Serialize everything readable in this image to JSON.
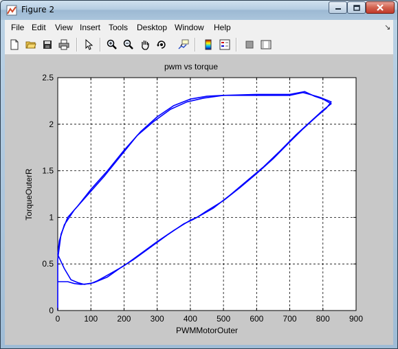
{
  "window": {
    "title": "Figure 2"
  },
  "menu": [
    "File",
    "Edit",
    "View",
    "Insert",
    "Tools",
    "Desktop",
    "Window",
    "Help"
  ],
  "toolbar": [
    {
      "icon": "new-figure-icon"
    },
    {
      "icon": "open-file-icon"
    },
    {
      "icon": "save-icon"
    },
    {
      "icon": "print-icon"
    },
    {
      "icon": "edit-plot-arrow-icon"
    },
    {
      "icon": "zoom-in-icon"
    },
    {
      "icon": "zoom-out-icon"
    },
    {
      "icon": "pan-hand-icon"
    },
    {
      "icon": "rotate-3d-icon"
    },
    {
      "icon": "data-cursor-icon"
    },
    {
      "icon": "insert-colorbar-icon"
    },
    {
      "icon": "insert-legend-icon"
    },
    {
      "icon": "hide-plot-tools-icon"
    },
    {
      "icon": "show-plot-tools-icon"
    }
  ],
  "chart_data": {
    "type": "line",
    "title": "pwm vs torque",
    "xlabel": "PWMMotorOuter",
    "ylabel": "TorqueOuterR",
    "xlim": [
      0,
      900
    ],
    "ylim": [
      0,
      2.5
    ],
    "xticks": [
      "0",
      "100",
      "200",
      "300",
      "400",
      "500",
      "600",
      "700",
      "800",
      "900"
    ],
    "yticks": [
      "0",
      "0.5",
      "1",
      "1.5",
      "2",
      "2.5"
    ],
    "grid": true,
    "color": "#0000ff",
    "series": [
      {
        "x": [
          0,
          0,
          10,
          30,
          60,
          100,
          150,
          200,
          250,
          300,
          350,
          400,
          450,
          500,
          600,
          700,
          740,
          760,
          790,
          825,
          810,
          780,
          740,
          700,
          650,
          600,
          550,
          500,
          450,
          420,
          400,
          350,
          300,
          250,
          200,
          160,
          120,
          100,
          70,
          50,
          30,
          0
        ],
        "y": [
          0,
          0.55,
          0.82,
          1.0,
          1.12,
          1.3,
          1.5,
          1.72,
          1.92,
          2.08,
          2.2,
          2.27,
          2.3,
          2.31,
          2.31,
          2.31,
          2.34,
          2.32,
          2.29,
          2.24,
          2.17,
          2.08,
          1.95,
          1.81,
          1.63,
          1.47,
          1.32,
          1.18,
          1.07,
          1.0,
          0.97,
          0.86,
          0.74,
          0.61,
          0.48,
          0.4,
          0.32,
          0.29,
          0.28,
          0.29,
          0.31,
          0.31
        ]
      },
      {
        "x": [
          0,
          5,
          20,
          50,
          90,
          140,
          190,
          240,
          290,
          340,
          390,
          440,
          500,
          600,
          700,
          745,
          775,
          800,
          825,
          800,
          760,
          720,
          670,
          620,
          570,
          520,
          470,
          440,
          410,
          380,
          330,
          280,
          230,
          190,
          150,
          110,
          80,
          60,
          40,
          20,
          0
        ],
        "y": [
          0.6,
          0.75,
          0.92,
          1.08,
          1.24,
          1.44,
          1.66,
          1.88,
          2.03,
          2.16,
          2.24,
          2.28,
          2.31,
          2.32,
          2.32,
          2.35,
          2.3,
          2.27,
          2.22,
          2.15,
          2.02,
          1.89,
          1.71,
          1.54,
          1.39,
          1.24,
          1.1,
          1.04,
          0.98,
          0.93,
          0.81,
          0.68,
          0.55,
          0.46,
          0.36,
          0.3,
          0.28,
          0.3,
          0.33,
          0.45,
          0.6
        ]
      }
    ]
  }
}
